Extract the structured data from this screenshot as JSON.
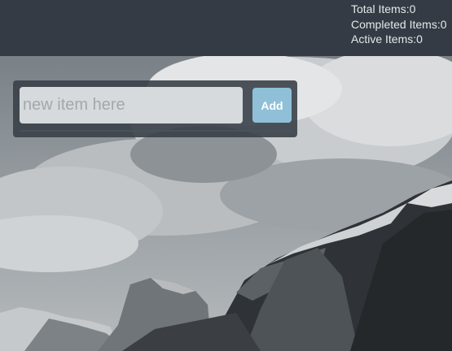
{
  "stats": {
    "total": "Total Items:0",
    "completed": "Completed Items:0",
    "active": "Active Items:0"
  },
  "new_item": {
    "placeholder": "new item here",
    "value": ""
  },
  "add_button": {
    "label": "Add"
  },
  "colors": {
    "topbar": "#353b44",
    "accent": "#8fc0d8",
    "panel": "#3a4048"
  }
}
